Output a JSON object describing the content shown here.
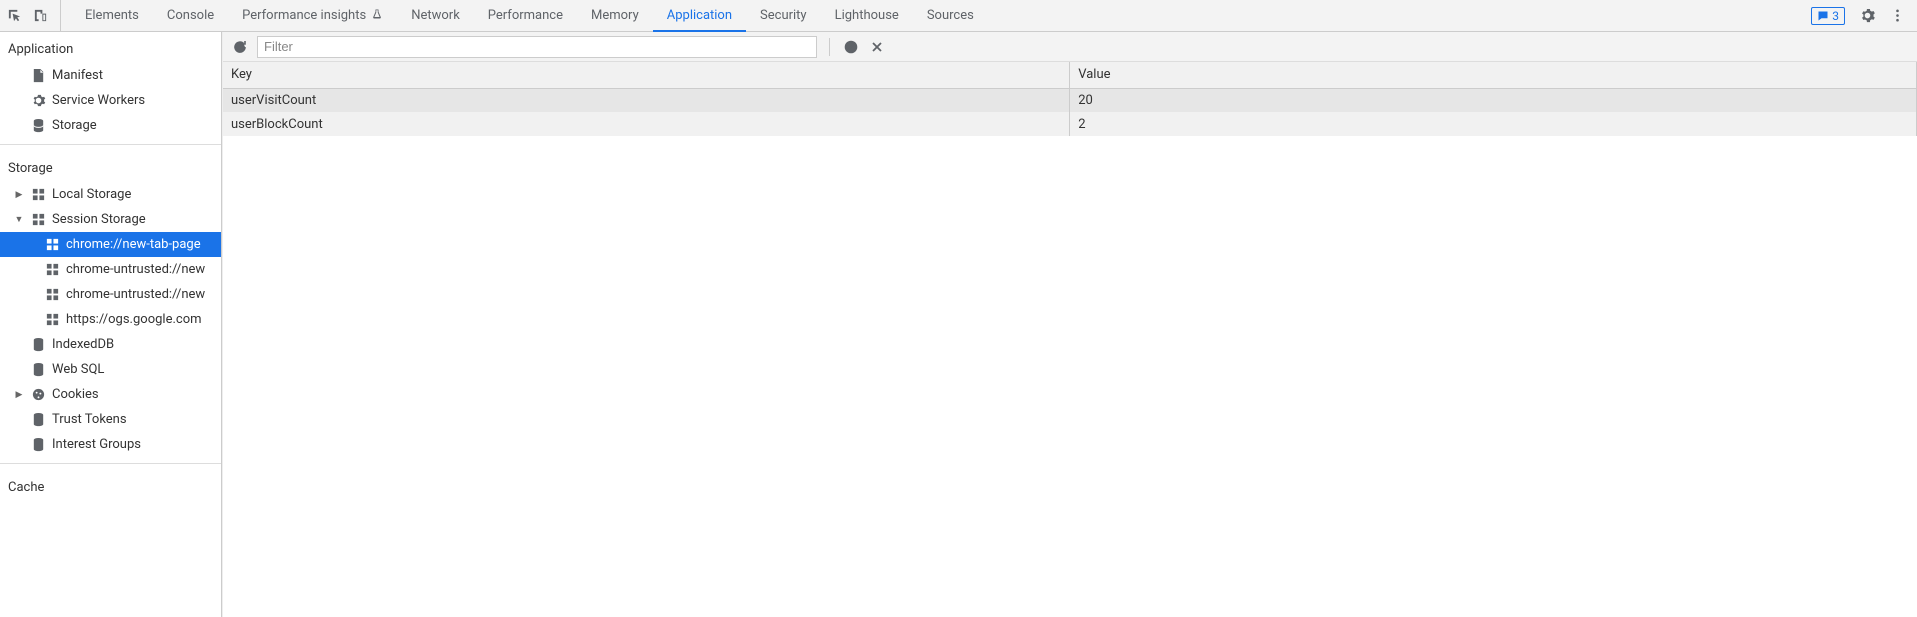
{
  "top_tabs": {
    "elements": "Elements",
    "console": "Console",
    "perf_insights": "Performance insights",
    "network": "Network",
    "performance": "Performance",
    "memory": "Memory",
    "application": "Application",
    "security": "Security",
    "lighthouse": "Lighthouse",
    "sources": "Sources"
  },
  "messages_count": "3",
  "sidebar": {
    "section_application": "Application",
    "manifest": "Manifest",
    "service_workers": "Service Workers",
    "storage_item": "Storage",
    "section_storage": "Storage",
    "local_storage": "Local Storage",
    "session_storage": "Session Storage",
    "ss_items": [
      "chrome://new-tab-page",
      "chrome-untrusted://new",
      "chrome-untrusted://new",
      "https://ogs.google.com"
    ],
    "indexeddb": "IndexedDB",
    "websql": "Web SQL",
    "cookies": "Cookies",
    "trust_tokens": "Trust Tokens",
    "interest_groups": "Interest Groups",
    "section_cache": "Cache"
  },
  "filter": {
    "placeholder": "Filter"
  },
  "table": {
    "headers": {
      "key": "Key",
      "value": "Value"
    },
    "rows": [
      {
        "key": "userVisitCount",
        "value": "20"
      },
      {
        "key": "userBlockCount",
        "value": "2"
      }
    ]
  }
}
